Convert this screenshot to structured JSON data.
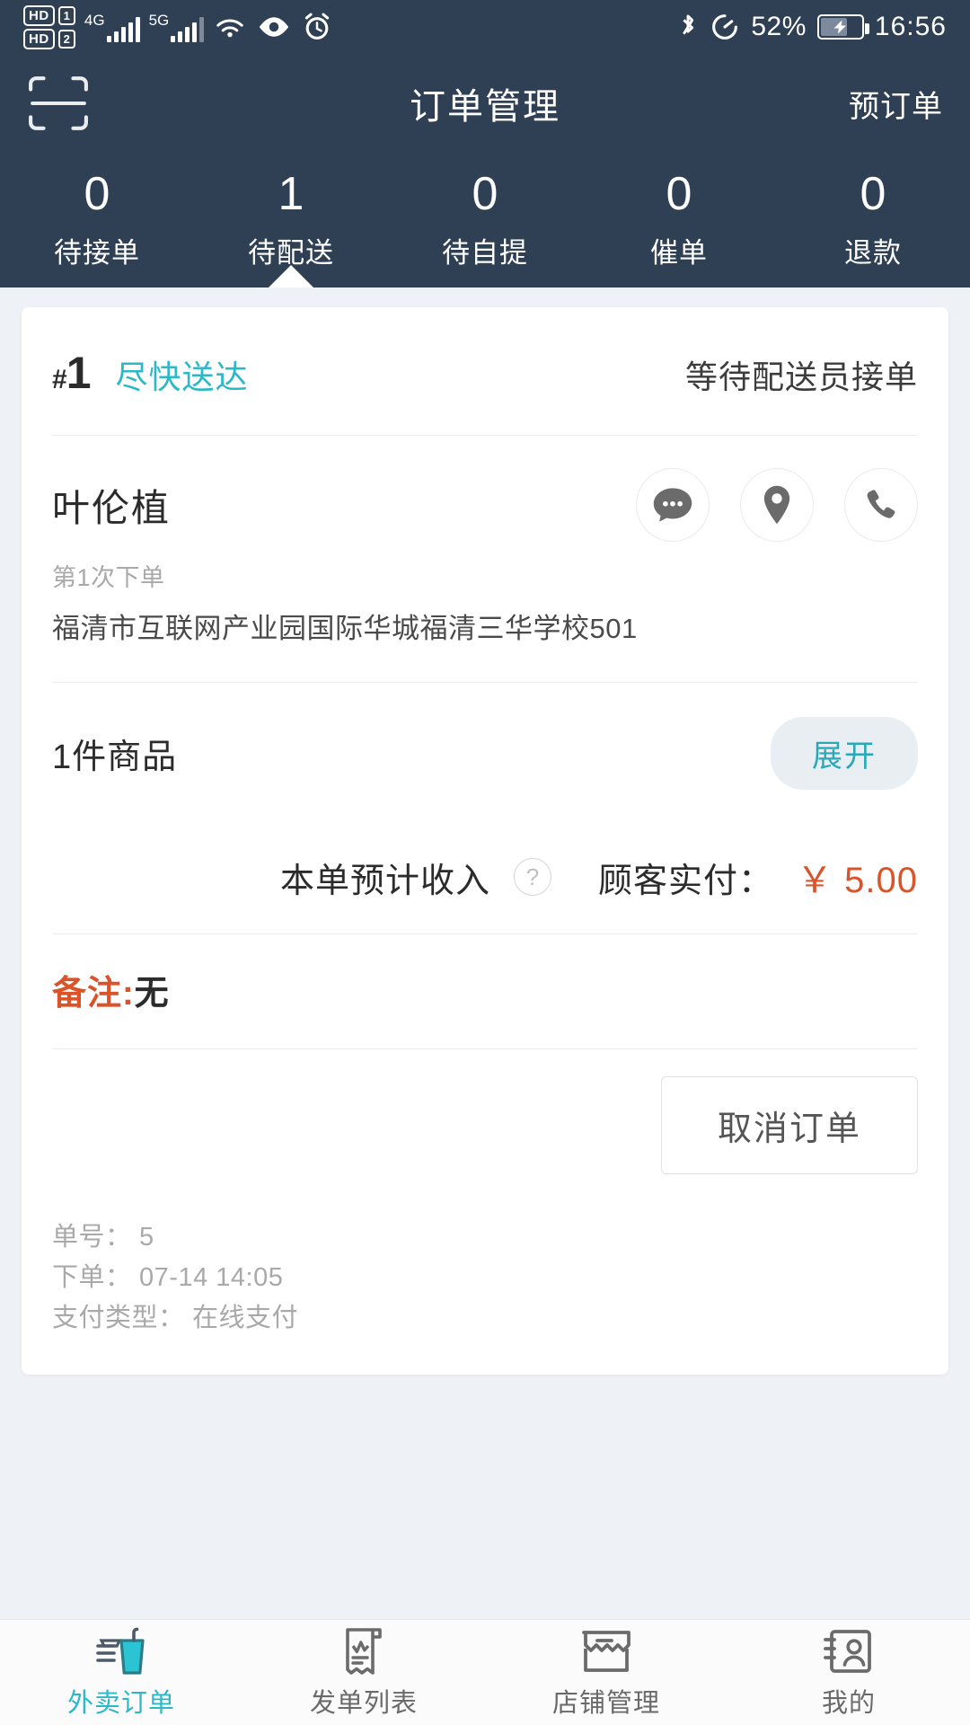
{
  "statusbar": {
    "hd1": "HD",
    "hd1_num": "1",
    "hd2": "HD",
    "hd2_num": "2",
    "net1": "4G",
    "net2": "5G",
    "battery_pct": "52%",
    "time": "16:56",
    "icons": [
      "wifi-icon",
      "eye-icon",
      "alarm-icon",
      "bluetooth-icon",
      "data-saver-icon",
      "battery-charging-icon"
    ]
  },
  "header": {
    "title": "订单管理",
    "preorder": "预订单",
    "scan_icon": "scan-icon",
    "tabs": [
      {
        "count": "0",
        "label": "待接单",
        "active": false
      },
      {
        "count": "1",
        "label": "待配送",
        "active": true
      },
      {
        "count": "0",
        "label": "待自提",
        "active": false
      },
      {
        "count": "0",
        "label": "催单",
        "active": false
      },
      {
        "count": "0",
        "label": "退款",
        "active": false
      }
    ]
  },
  "order": {
    "hash": "#",
    "number": "1",
    "delivery_tag": "尽快送达",
    "status": "等待配送员接单",
    "customer_name": "叶伦植",
    "order_times": "第1次下单",
    "address": "福清市互联网产业园国际华城福清三华学校501",
    "actions": [
      "chat-icon",
      "location-icon",
      "phone-icon"
    ],
    "goods_count": "1件商品",
    "expand_label": "展开",
    "income_label": "本单预计收入",
    "help_mark": "?",
    "pay_label": "顾客实付：",
    "pay_amount": "￥ 5.00",
    "remark_key": "备注:",
    "remark_value": "无",
    "cancel_label": "取消订单",
    "footer": [
      "单号： 5",
      "下单： 07-14 14:05",
      "支付类型： 在线支付"
    ]
  },
  "bottomnav": [
    {
      "label": "外卖订单",
      "icon": "drink-cup-icon",
      "active": true
    },
    {
      "label": "发单列表",
      "icon": "receipt-icon",
      "active": false
    },
    {
      "label": "店铺管理",
      "icon": "shop-icon",
      "active": false
    },
    {
      "label": "我的",
      "icon": "profile-card-icon",
      "active": false
    }
  ],
  "colors": {
    "header_bg": "#2f4055",
    "accent": "#2cb8c6",
    "price": "#d9542b",
    "page_bg": "#eef1f5"
  }
}
